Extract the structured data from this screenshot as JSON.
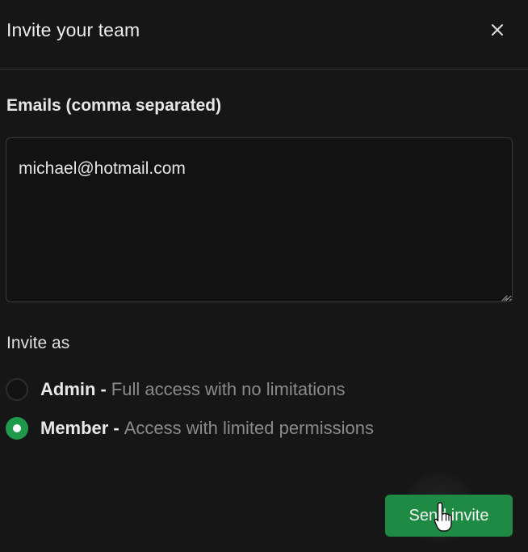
{
  "dialog": {
    "title": "Invite your team",
    "close_icon": "close-icon"
  },
  "emails": {
    "label": "Emails (comma separated)",
    "value": "michael@hotmail.com"
  },
  "invite_as": {
    "label": "Invite as",
    "options": [
      {
        "name": "Admin",
        "separator": "-",
        "description": "Full access with no limitations",
        "selected": false
      },
      {
        "name": "Member",
        "separator": "-",
        "description": "Access with limited permissions",
        "selected": true
      }
    ]
  },
  "actions": {
    "send_label": "Send invite",
    "accent_color": "#1f8a43"
  },
  "cursor": {
    "icon": "hand-pointer-icon"
  }
}
